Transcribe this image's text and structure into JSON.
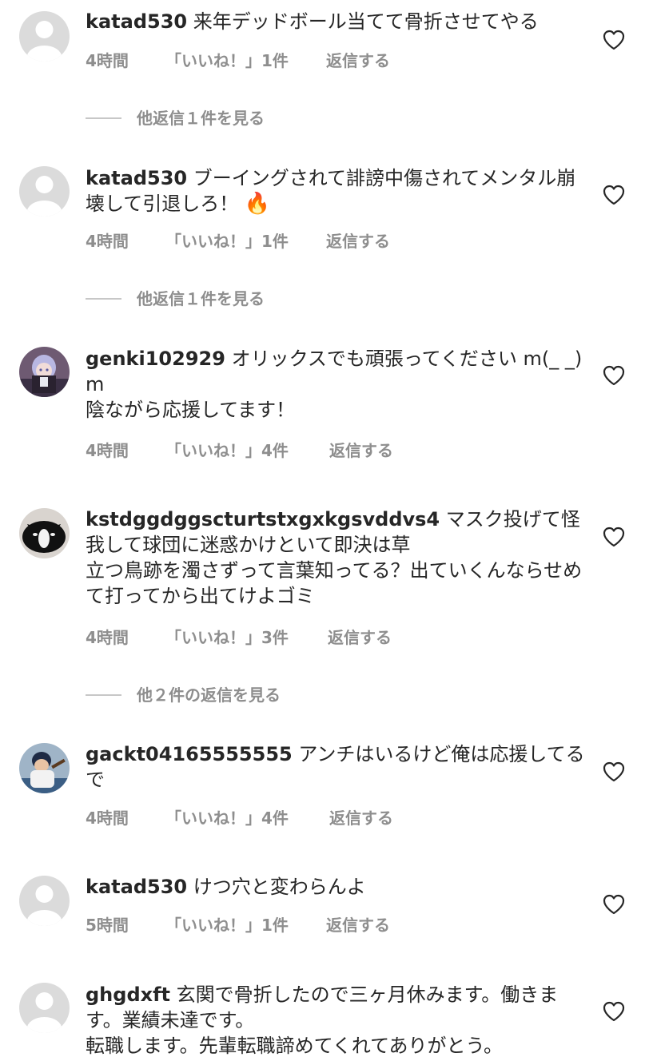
{
  "comments": [
    {
      "username": "katad530",
      "text": " 来年デッドボール当てて骨折させてやる",
      "time": "4時間",
      "likes": "「いいね！」1件",
      "reply": "返信する",
      "avatar": "default-avatar"
    },
    {
      "username": "katad530",
      "text": " ブーイングされて誹謗中傷されてメンタル崩壊して引退しろ！",
      "emoji": "🔥",
      "time": "4時間",
      "likes": "「いいね！」1件",
      "reply": "返信する",
      "avatar": "default-avatar"
    },
    {
      "username": "genki102929",
      "text": " オリックスでも頑張ってください m(_ _)m\n陰ながら応援してます！",
      "time": "4時間",
      "likes": "「いいね！」4件",
      "reply": "返信する",
      "avatar": "anime-character-avatar"
    },
    {
      "username": "kstdggdggscturtstxgxkgsvddvs4",
      "text": " マスク投げて怪我して球団に迷惑かけといて即決は草\n立つ鳥跡を濁さずって言葉知ってる？出ていくんならせめて打ってから出てけよゴミ",
      "time": "4時間",
      "likes": "「いいね！」3件",
      "reply": "返信する",
      "avatar": "cat-avatar"
    },
    {
      "username": "gackt04165555555",
      "text": " アンチはいるけど俺は応援してるで",
      "time": "4時間",
      "likes": "「いいね！」4件",
      "reply": "返信する",
      "avatar": "baseball-player-avatar"
    },
    {
      "username": "katad530",
      "text": " けつ穴と変わらんよ",
      "time": "5時間",
      "likes": "「いいね！」1件",
      "reply": "返信する",
      "avatar": "default-avatar"
    },
    {
      "username": "ghgdxft",
      "text": " 玄関で骨折したので三ヶ月休みます。働きます。業績未達です。\n転職します。先輩転職諦めてくれてありがとう。",
      "time": "",
      "likes": "",
      "reply": "",
      "avatar": "default-avatar"
    }
  ],
  "view_replies": [
    "他返信１件を見る",
    "他返信１件を見る",
    "他２件の返信を見る"
  ],
  "colors": {
    "text": "#262626",
    "secondary": "#8e8e8e",
    "divider": "#c7c7c7",
    "avatar_default_bg": "#dbdbdb"
  }
}
